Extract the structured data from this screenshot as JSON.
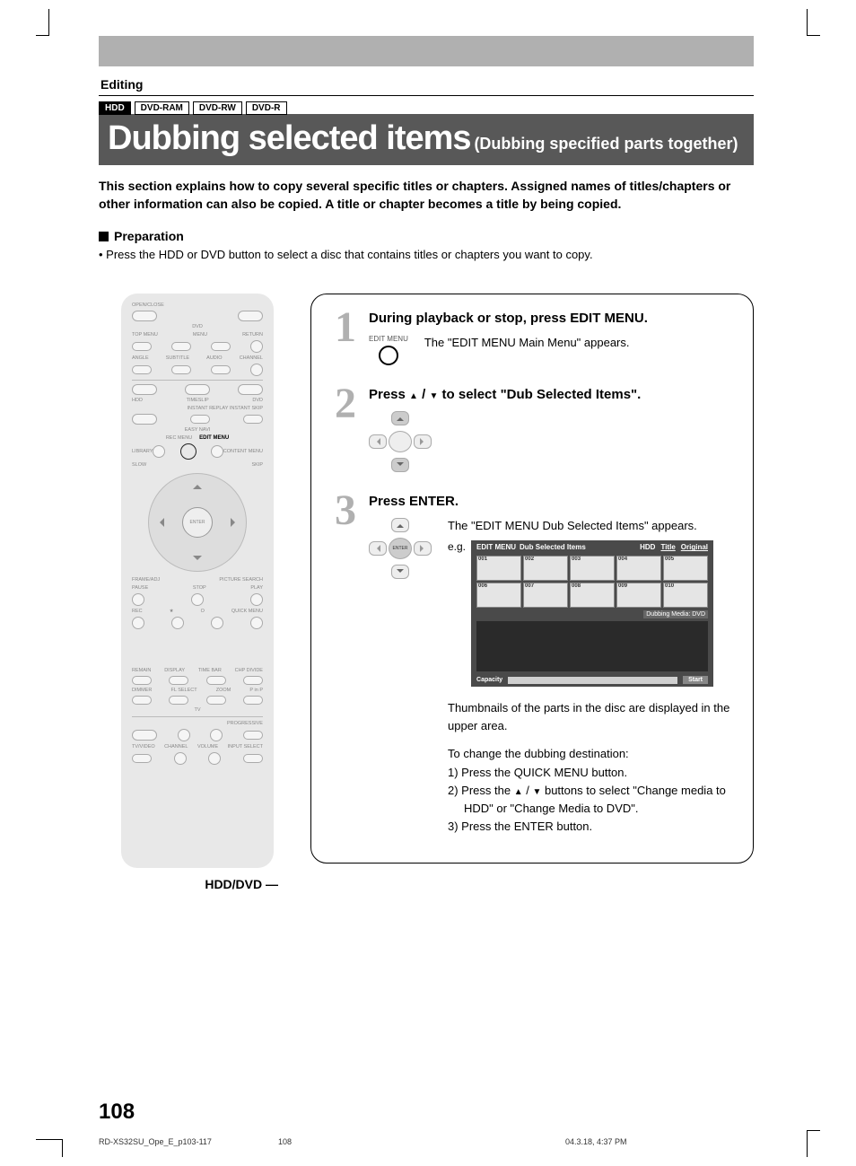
{
  "section_label": "Editing",
  "badges": {
    "hdd": "HDD",
    "ram": "DVD-RAM",
    "rw": "DVD-RW",
    "r": "DVD-R"
  },
  "title": {
    "main": "Dubbing selected items",
    "sub": "(Dubbing specified parts together)"
  },
  "intro": "This section explains how to copy several specific titles or chapters. Assigned names of titles/chapters or other information can also be copied. A title or chapter becomes a title by being copied.",
  "preparation": {
    "label": "Preparation",
    "bullet": "• Press the HDD or DVD button to select a disc that contains titles or chapters you want to copy."
  },
  "remote": {
    "open_close": "OPEN/CLOSE",
    "dvd": "DVD",
    "top_menu": "TOP MENU",
    "menu": "MENU",
    "return": "RETURN",
    "angle": "ANGLE",
    "subtitle": "SUBTITLE",
    "audio": "AUDIO",
    "channel_up": "CHANNEL",
    "hdd": "HDD",
    "timeslip": "TIMESLIP",
    "dvd2": "DVD",
    "instant_replay": "INSTANT REPLAY",
    "instant_skip": "INSTANT SKIP",
    "easy_navi": "EASY NAVI",
    "rec_menu": "REC MENU",
    "edit_menu": "EDIT MENU",
    "library": "LIBRARY",
    "content_menu": "CONTENT MENU",
    "slow": "SLOW",
    "skip": "SKIP",
    "enter": "ENTER",
    "frame": "FRAME/ADJ",
    "picture": "PICTURE SEARCH",
    "pause": "PAUSE",
    "stop": "STOP",
    "play": "PLAY",
    "rec": "REC",
    "star": "★",
    "circle": "O",
    "quick_menu": "QUICK MENU",
    "remain": "REMAIN",
    "display": "DISPLAY",
    "timebar": "TIME BAR",
    "chpdivide": "CHP DIVIDE",
    "dimmer": "DIMMER",
    "flselect": "FL SELECT",
    "zoom": "ZOOM",
    "pinp": "P in P",
    "tv": "TV",
    "progressive": "PROGRESSIVE",
    "tvvideo": "TV/VIDEO",
    "channel": "CHANNEL",
    "volume": "VOLUME",
    "input": "INPUT SELECT",
    "hdd_dvd_label": "HDD/DVD"
  },
  "steps": {
    "s1": {
      "num": "1",
      "title": "During playback or stop, press EDIT MENU.",
      "icon_label": "EDIT MENU",
      "text": "The \"EDIT MENU Main Menu\" appears."
    },
    "s2": {
      "num": "2",
      "title_a": "Press ",
      "title_b": " / ",
      "title_c": " to select \"Dub Selected Items\"."
    },
    "s3": {
      "num": "3",
      "title": "Press ENTER.",
      "enter_label": "ENTER",
      "text": "The \"EDIT MENU Dub Selected Items\" appears.",
      "eg_label": "e.g.",
      "screen": {
        "brand": "EDIT MENU",
        "mode": "Dub Selected Items",
        "source": "HDD",
        "tab_title": "Title",
        "tab_original": "Original",
        "thumbs": [
          "001",
          "002",
          "003",
          "004",
          "005",
          "006",
          "007",
          "008",
          "009",
          "010"
        ],
        "media": "Dubbing Media: DVD",
        "capacity": "Capacity",
        "start": "Start"
      },
      "desc1": "Thumbnails of the parts in the disc are displayed in the upper area.",
      "desc2": "To change the dubbing destination:",
      "l1": "1)  Press the QUICK MENU button.",
      "l2a": "2)  Press the ",
      "l2b": " / ",
      "l2c": " buttons to select \"Change media to HDD\" or \"Change Media to DVD\".",
      "l3": "3)  Press the ENTER button."
    }
  },
  "page_number": "108",
  "footer": {
    "file": "RD-XS32SU_Ope_E_p103-117",
    "page": "108",
    "date": "04.3.18, 4:37 PM"
  }
}
